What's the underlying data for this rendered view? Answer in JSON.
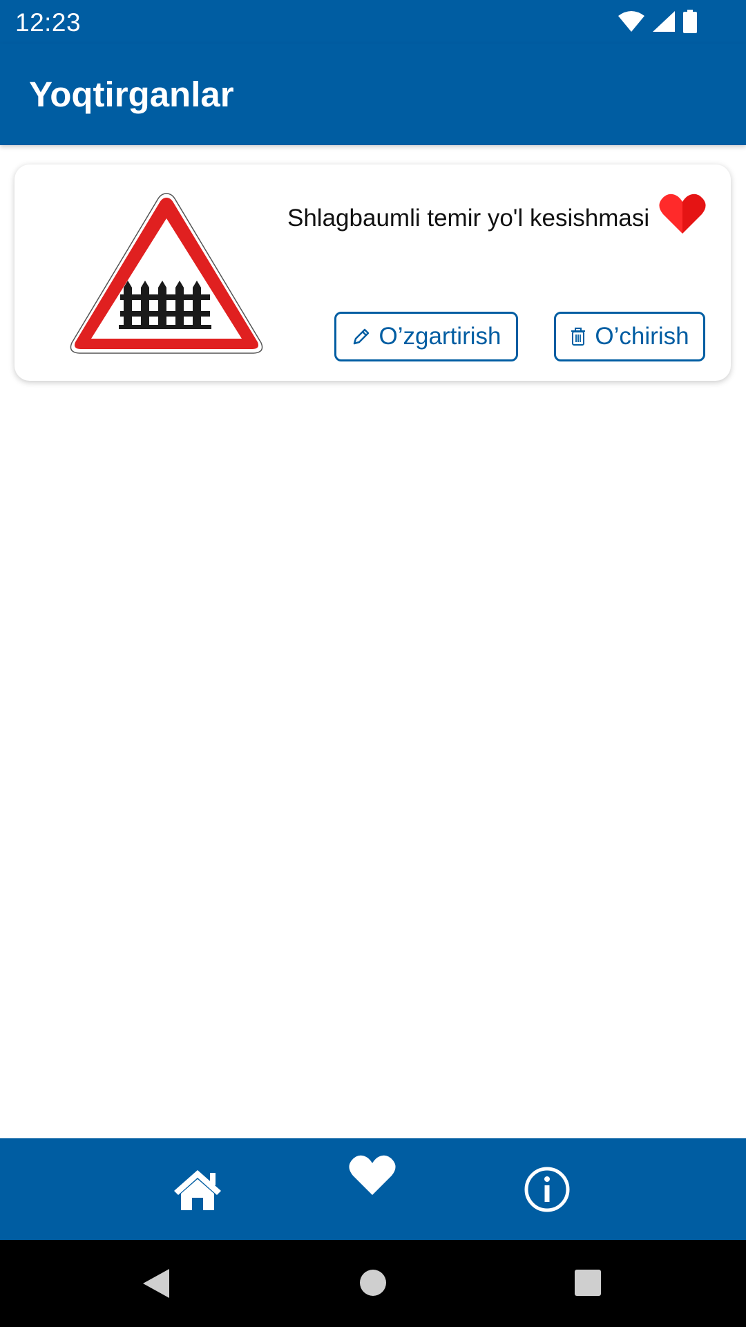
{
  "status_bar": {
    "time": "12:23",
    "icons": [
      "wifi-icon",
      "signal-icon",
      "battery-icon"
    ]
  },
  "app_bar": {
    "title": "Yoqtirganlar"
  },
  "favorites": [
    {
      "title": "Shlagbaumli temir yo'l kesishmasi",
      "image_icon": "railway-crossing-with-barrier-sign",
      "is_favorite": true,
      "edit_label": "O’zgartirish",
      "delete_label": "O’chirish"
    }
  ],
  "bottom_nav": {
    "items": [
      {
        "icon": "home-icon",
        "active": false
      },
      {
        "icon": "heart-icon",
        "active": true
      },
      {
        "icon": "info-icon",
        "active": false
      }
    ]
  },
  "colors": {
    "primary": "#005da2",
    "heart": "#ff2a2a",
    "sign_red": "#e02020",
    "background": "#ffffff",
    "system_nav": "#000000"
  }
}
